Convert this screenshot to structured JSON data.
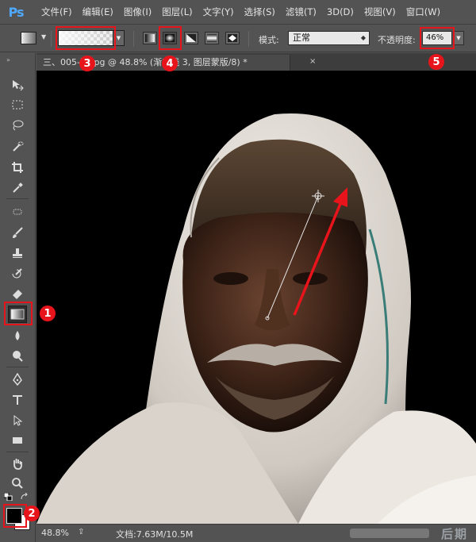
{
  "app": {
    "logo": "Ps"
  },
  "menu": [
    "文件(F)",
    "编辑(E)",
    "图像(I)",
    "图层(L)",
    "文字(Y)",
    "选择(S)",
    "滤镜(T)",
    "3D(D)",
    "视图(V)",
    "窗口(W)"
  ],
  "options": {
    "mode_label": "模式:",
    "mode_value": "正常",
    "opacity_label": "不透明度:",
    "opacity_value": "46%"
  },
  "document": {
    "tab_title": "三、005-图.jpg @ 48.8% (渐变线 3, 图层蒙版/8) *",
    "tab_close": "×"
  },
  "status": {
    "zoom": "48.8%",
    "doc_info": "文档:7.63M/10.5M",
    "watermark": "后期强"
  },
  "annotations": [
    "1",
    "2",
    "3",
    "4",
    "5"
  ],
  "colors": {
    "highlight": "#e8141b",
    "foreground": "#000000",
    "background": "#ffffff"
  },
  "tools": [
    "move-tool",
    "marquee-tool",
    "lasso-tool",
    "quick-selection-tool",
    "crop-tool",
    "eyedropper-tool",
    "spot-healing-tool",
    "brush-tool",
    "clone-stamp-tool",
    "history-brush-tool",
    "eraser-tool",
    "gradient-tool",
    "blur-tool",
    "dodge-tool",
    "pen-tool",
    "type-tool",
    "path-selection-tool",
    "rectangle-tool",
    "hand-tool",
    "zoom-tool"
  ]
}
